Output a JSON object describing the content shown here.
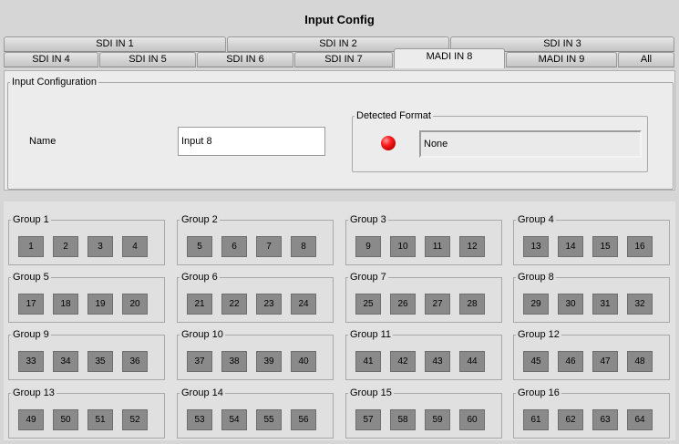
{
  "title": "Input Config",
  "tabs_row1": [
    "SDI IN 1",
    "SDI IN 2",
    "SDI IN 3"
  ],
  "tabs_row2": [
    "SDI IN 4",
    "SDI IN 5",
    "SDI IN 6",
    "SDI IN 7",
    "MADI IN 8",
    "MADI IN 9",
    "All"
  ],
  "active_tab": "MADI IN 8",
  "input_configuration": {
    "legend": "Input Configuration",
    "name_label": "Name",
    "name_value": "Input 8",
    "detected_format": {
      "legend": "Detected Format",
      "value": "None",
      "led_color": "#e01010"
    }
  },
  "groups": [
    {
      "label": "Group 1",
      "channels": [
        "1",
        "2",
        "3",
        "4"
      ]
    },
    {
      "label": "Group 2",
      "channels": [
        "5",
        "6",
        "7",
        "8"
      ]
    },
    {
      "label": "Group 3",
      "channels": [
        "9",
        "10",
        "11",
        "12"
      ]
    },
    {
      "label": "Group 4",
      "channels": [
        "13",
        "14",
        "15",
        "16"
      ]
    },
    {
      "label": "Group 5",
      "channels": [
        "17",
        "18",
        "19",
        "20"
      ]
    },
    {
      "label": "Group 6",
      "channels": [
        "21",
        "22",
        "23",
        "24"
      ]
    },
    {
      "label": "Group 7",
      "channels": [
        "25",
        "26",
        "27",
        "28"
      ]
    },
    {
      "label": "Group 8",
      "channels": [
        "29",
        "30",
        "31",
        "32"
      ]
    },
    {
      "label": "Group 9",
      "channels": [
        "33",
        "34",
        "35",
        "36"
      ]
    },
    {
      "label": "Group 10",
      "channels": [
        "37",
        "38",
        "39",
        "40"
      ]
    },
    {
      "label": "Group 11",
      "channels": [
        "41",
        "42",
        "43",
        "44"
      ]
    },
    {
      "label": "Group 12",
      "channels": [
        "45",
        "46",
        "47",
        "48"
      ]
    },
    {
      "label": "Group 13",
      "channels": [
        "49",
        "50",
        "51",
        "52"
      ]
    },
    {
      "label": "Group 14",
      "channels": [
        "53",
        "54",
        "55",
        "56"
      ]
    },
    {
      "label": "Group 15",
      "channels": [
        "57",
        "58",
        "59",
        "60"
      ]
    },
    {
      "label": "Group 16",
      "channels": [
        "61",
        "62",
        "63",
        "64"
      ]
    }
  ]
}
